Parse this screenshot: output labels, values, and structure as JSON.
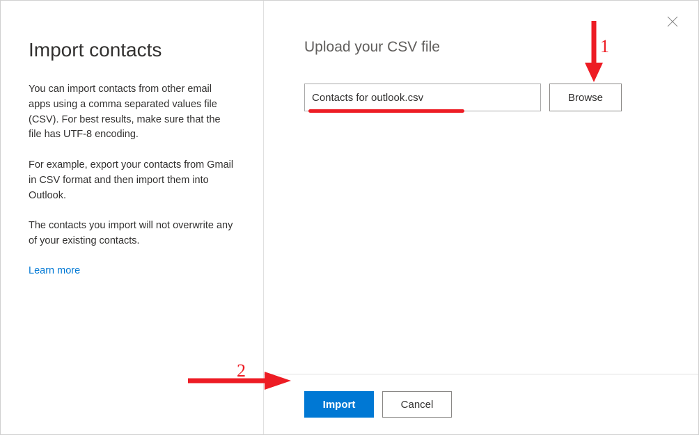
{
  "leftPanel": {
    "title": "Import contacts",
    "para1": "You can import contacts from other email apps using a comma separated values file (CSV). For best results, make sure that the file has UTF-8 encoding.",
    "para2": "For example, export your contacts from Gmail in CSV format and then import them into Outlook.",
    "para3": "The contacts you import will not overwrite any of your existing contacts.",
    "learnMore": "Learn more"
  },
  "rightPanel": {
    "uploadLabel": "Upload your CSV file",
    "fileValue": "Contacts for outlook.csv",
    "browseLabel": "Browse"
  },
  "footer": {
    "importLabel": "Import",
    "cancelLabel": "Cancel"
  },
  "annotations": {
    "step1": "1",
    "step2": "2"
  }
}
